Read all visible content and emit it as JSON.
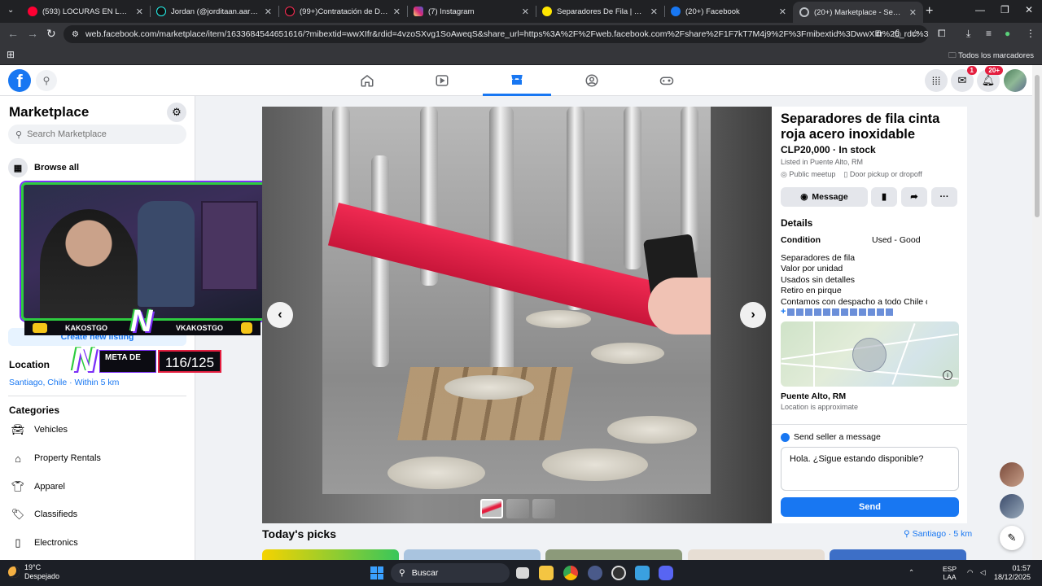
{
  "browser": {
    "tabs": [
      {
        "title": "(593) LOCURAS EN LA FERIA N",
        "favicon_color": "#ff0033",
        "active": false
      },
      {
        "title": "Jordan (@jorditaan.aaron) | Tik",
        "favicon_color": "#000000",
        "active": false
      },
      {
        "title": "(99+)Contratación de DJ en Ch",
        "favicon_color": "#000000",
        "active": false
      },
      {
        "title": "(7) Instagram",
        "favicon_color": "#d62976",
        "active": false
      },
      {
        "title": "Separadores De Fila | Mercadol",
        "favicon_color": "#ffe600",
        "active": false
      },
      {
        "title": "(20+) Facebook",
        "favicon_color": "#1877f2",
        "active": false
      },
      {
        "title": "(20+) Marketplace - Separado",
        "favicon_color": "#1877f2",
        "active": true
      }
    ],
    "url": "web.facebook.com/marketplace/item/1633684544651616/?mibextid=wwXIfr&rdid=4vzoSXvg1SoAweqS&share_url=https%3A%2F%2Fweb.facebook.com%2Fshare%2F1F7kT7M4j9%2F%3Fmibextid%3DwwXIfr%26_rdc%3D1%26_rdr#",
    "bookmarks_all": "Todos los marcadores"
  },
  "header": {
    "messenger_badge": "1",
    "notifications_badge": "20+"
  },
  "sidebar": {
    "title": "Marketplace",
    "search_placeholder": "Search Marketplace",
    "browse_all": "Browse all",
    "create_listing": "Create new listing",
    "location_heading": "Location",
    "location_value": "Santiago, Chile · Within 5 km",
    "categories_heading": "Categories",
    "categories": [
      {
        "label": "Vehicles",
        "icon": "car-icon"
      },
      {
        "label": "Property Rentals",
        "icon": "house-icon"
      },
      {
        "label": "Apparel",
        "icon": "shirt-icon"
      },
      {
        "label": "Classifieds",
        "icon": "tag-icon"
      },
      {
        "label": "Electronics",
        "icon": "phone-icon"
      }
    ]
  },
  "overlay": {
    "left_name": "KAKOSTGO",
    "right_name": "VKAKOSTGO",
    "meta_label": "META DE",
    "meta_count": "116/125"
  },
  "listing": {
    "title": "Separadores de fila cinta roja acero inoxidable",
    "price": "CLP20,000 · In stock",
    "listed_in": "Listed in Puente Alto, RM",
    "meetup": "Public meetup",
    "pickup": "Door pickup or dropoff",
    "message_label": "Message",
    "details_heading": "Details",
    "condition_label": "Condition",
    "condition_value": "Used - Good",
    "description": [
      "Separadores de fila",
      "Valor por unidad",
      "Usados sin detalles",
      "Retiro en pirque",
      "Contamos con despacho a todo Chile cu"
    ],
    "location_name": "Puente Alto, RM",
    "location_note": "Location is approximate"
  },
  "send": {
    "label": "Send seller a message",
    "message_value": "Hola. ¿Sigue estando disponible?",
    "send_label": "Send"
  },
  "picks": {
    "heading": "Today's picks",
    "location": "Santiago · 5 km"
  },
  "taskbar": {
    "temperature": "19°C",
    "condition": "Despejado",
    "search_label": "Buscar",
    "lang_1": "ESP",
    "lang_2": "LAA",
    "time": "01:57",
    "date": "18/12/2025"
  }
}
